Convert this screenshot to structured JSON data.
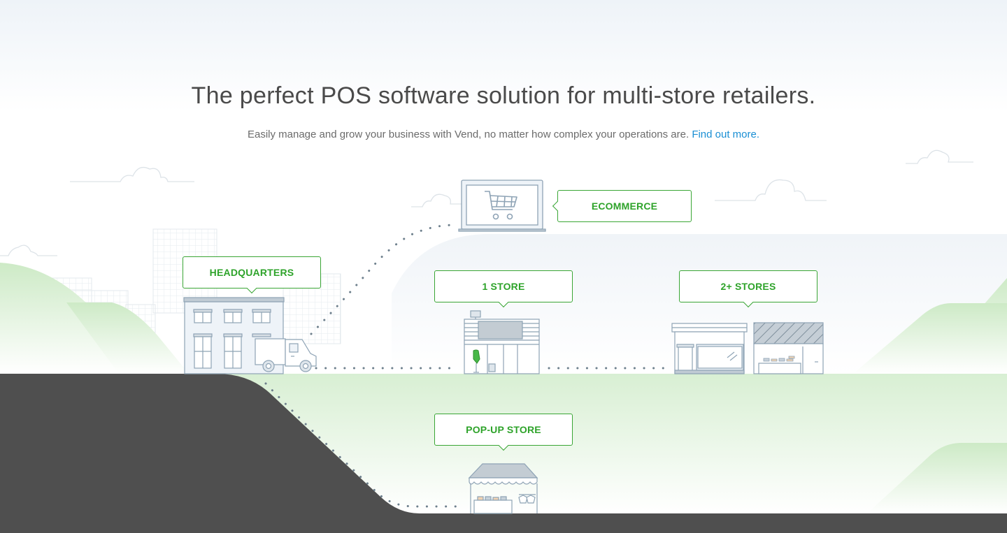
{
  "hero": {
    "title": "The perfect POS software solution for multi-store retailers.",
    "subtitle": "Easily manage and grow your business with Vend, no matter how complex your operations are.",
    "link_text": "Find out more."
  },
  "callouts": {
    "headquarters": "HEADQUARTERS",
    "ecommerce": "ECOMMERCE",
    "one_store": "1 STORE",
    "multi_store": "2+ STORES",
    "popup_store": "POP-UP STORE"
  },
  "colors": {
    "accent_green": "#2ea32a",
    "link_blue": "#1a8fd4",
    "ground_dark": "#4f4f4f",
    "hill_green": "#d5efd0",
    "line_art": "#8ea3b5",
    "dots": "#6d7f8c"
  },
  "icons": [
    "shopping-cart-icon",
    "laptop-icon",
    "headquarters-building-icon",
    "delivery-van-icon",
    "store-front-icon",
    "popup-stall-icon",
    "cloud-icon"
  ]
}
